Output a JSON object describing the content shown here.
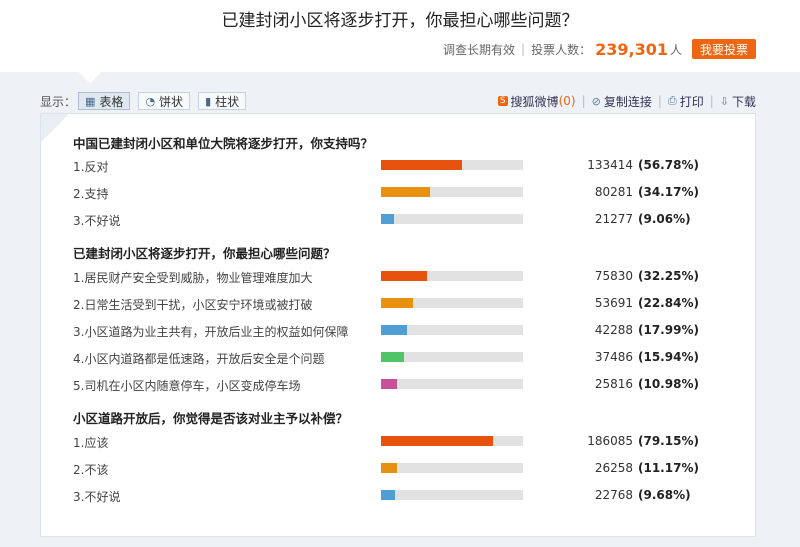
{
  "header": {
    "title": "已建封闭小区将逐步打开，你最担心哪些问题？",
    "duration": "调查长期有效",
    "voters_label": "投票人数：",
    "voters_count": "239,301",
    "voters_unit": "人",
    "vote_button": "我要投票"
  },
  "toolbar": {
    "display_label": "显示：",
    "modes": [
      {
        "label": "表格",
        "icon": "grid-icon",
        "active": true
      },
      {
        "label": "饼状",
        "icon": "pie-icon",
        "active": false
      },
      {
        "label": "柱状",
        "icon": "bar-chart-icon",
        "active": false
      }
    ],
    "sohu_weibo": "搜狐微博",
    "sohu_weibo_count": "(0)",
    "copy_link": "复制连接",
    "print": "打印",
    "download": "下载"
  },
  "questions": [
    {
      "title": "中国已建封闭小区和单位大院将逐步打开，你支持吗？",
      "options": [
        {
          "label": "1.反对",
          "votes": "133414",
          "percent": "(56.78%)",
          "fraction": 0.5678,
          "color": "#e8520f"
        },
        {
          "label": "2.支持",
          "votes": "80281",
          "percent": "(34.17%)",
          "fraction": 0.3417,
          "color": "#e8900f"
        },
        {
          "label": "3.不好说",
          "votes": "21277",
          "percent": "(9.06%)",
          "fraction": 0.0906,
          "color": "#4f9fd5"
        }
      ]
    },
    {
      "title": "已建封闭小区将逐步打开，你最担心哪些问题？",
      "options": [
        {
          "label": "1.居民财产安全受到威胁，物业管理难度加大",
          "votes": "75830",
          "percent": "(32.25%)",
          "fraction": 0.3225,
          "color": "#e8520f"
        },
        {
          "label": "2.日常生活受到干扰，小区安宁环境或被打破",
          "votes": "53691",
          "percent": "(22.84%)",
          "fraction": 0.2284,
          "color": "#e8900f"
        },
        {
          "label": "3.小区道路为业主共有，开放后业主的权益如何保障",
          "votes": "42288",
          "percent": "(17.99%)",
          "fraction": 0.1799,
          "color": "#4f9fd5"
        },
        {
          "label": "4.小区内道路都是低速路，开放后安全是个问题",
          "votes": "37486",
          "percent": "(15.94%)",
          "fraction": 0.1594,
          "color": "#52c468"
        },
        {
          "label": "5.司机在小区内随意停车，小区变成停车场",
          "votes": "25816",
          "percent": "(10.98%)",
          "fraction": 0.1098,
          "color": "#c9509a"
        }
      ]
    },
    {
      "title": "小区道路开放后，你觉得是否该对业主予以补偿？",
      "options": [
        {
          "label": "1.应该",
          "votes": "186085",
          "percent": "(79.15%)",
          "fraction": 0.7915,
          "color": "#e8520f"
        },
        {
          "label": "2.不该",
          "votes": "26258",
          "percent": "(11.17%)",
          "fraction": 0.1117,
          "color": "#e8900f"
        },
        {
          "label": "3.不好说",
          "votes": "22768",
          "percent": "(9.68%)",
          "fraction": 0.0968,
          "color": "#4f9fd5"
        }
      ]
    }
  ]
}
